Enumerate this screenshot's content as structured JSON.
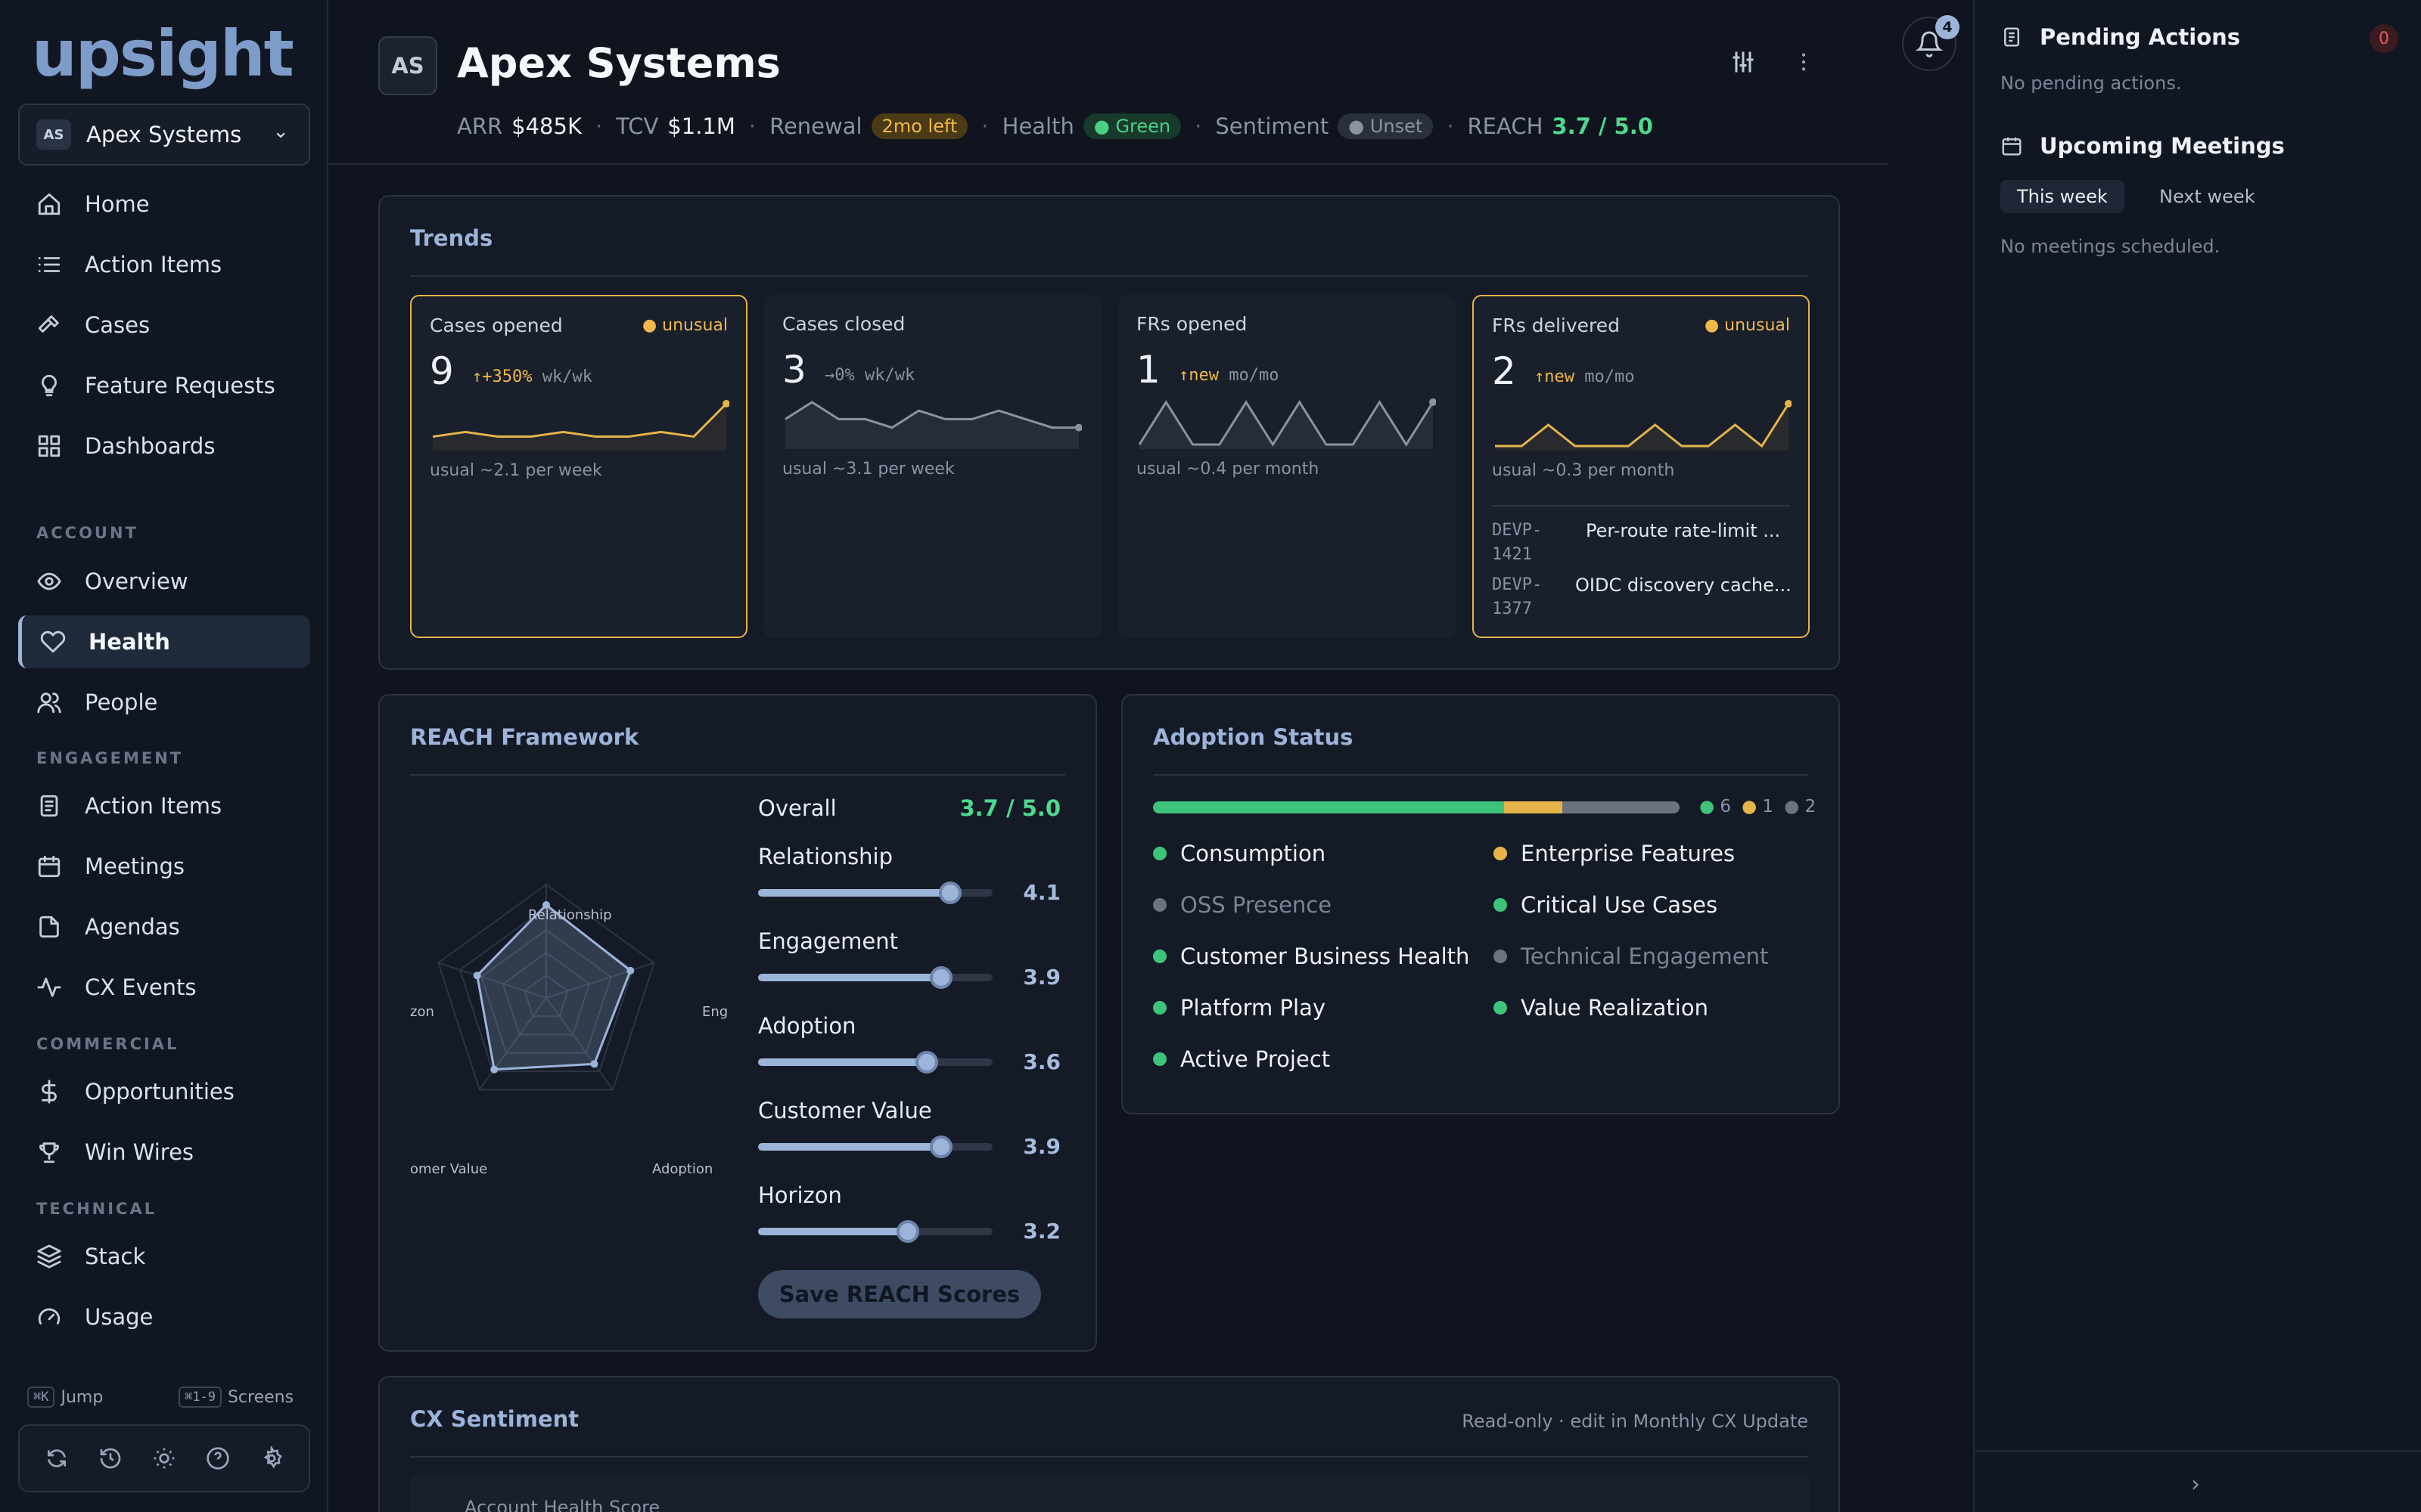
{
  "logo": "upsight",
  "account_switcher": {
    "initials": "AS",
    "name": "Apex Systems"
  },
  "nav_main": [
    {
      "label": "Home",
      "icon": "home-icon"
    },
    {
      "label": "Action Items",
      "icon": "list-icon"
    },
    {
      "label": "Cases",
      "icon": "hammer-icon"
    },
    {
      "label": "Feature Requests",
      "icon": "lightbulb-icon"
    },
    {
      "label": "Dashboards",
      "icon": "grid-icon"
    }
  ],
  "sections": {
    "account": "ACCOUNT",
    "engagement": "ENGAGEMENT",
    "commercial": "COMMERCIAL",
    "technical": "TECHNICAL"
  },
  "nav_account": [
    {
      "label": "Overview",
      "icon": "eye-icon"
    },
    {
      "label": "Health",
      "icon": "heart-icon",
      "active": true
    },
    {
      "label": "People",
      "icon": "people-icon"
    }
  ],
  "nav_engagement": [
    {
      "label": "Action Items",
      "icon": "document-icon"
    },
    {
      "label": "Meetings",
      "icon": "calendar-icon"
    },
    {
      "label": "Agendas",
      "icon": "file-icon"
    },
    {
      "label": "CX Events",
      "icon": "activity-icon"
    }
  ],
  "nav_commercial": [
    {
      "label": "Opportunities",
      "icon": "dollar-icon"
    },
    {
      "label": "Win Wires",
      "icon": "trophy-icon"
    }
  ],
  "nav_technical": [
    {
      "label": "Stack",
      "icon": "layers-icon"
    },
    {
      "label": "Usage",
      "icon": "gauge-icon"
    }
  ],
  "shortcuts": {
    "jump_key": "⌘K",
    "jump_label": "Jump",
    "screens_key": "⌘1-9",
    "screens_label": "Screens"
  },
  "header": {
    "initials": "AS",
    "title": "Apex Systems",
    "arr_label": "ARR",
    "arr": "$485K",
    "tcv_label": "TCV",
    "tcv": "$1.1M",
    "renewal_label": "Renewal",
    "renewal": "2mo left",
    "health_label": "Health",
    "health": "Green",
    "sentiment_label": "Sentiment",
    "sentiment": "Unset",
    "reach_label": "REACH",
    "reach": "3.7 / 5.0",
    "notifications": "4"
  },
  "trends": {
    "title": "Trends",
    "cards": [
      {
        "label": "Cases opened",
        "unusual": "unusual",
        "value": "9",
        "delta": "↑+350%",
        "period": "wk/wk",
        "usual": "usual ~2.1 per week",
        "series": [
          2,
          3,
          2,
          2,
          3,
          2,
          2,
          3,
          2,
          9
        ]
      },
      {
        "label": "Cases closed",
        "value": "3",
        "delta": "→0%",
        "period": "wk/wk",
        "usual": "usual ~3.1 per week",
        "series": [
          3,
          5,
          3,
          3,
          2,
          4,
          3,
          3,
          4,
          3,
          2,
          2
        ]
      },
      {
        "label": "FRs opened",
        "value": "1",
        "delta": "↑new",
        "period": "mo/mo",
        "usual": "usual ~0.4 per month",
        "series": [
          0,
          1,
          0,
          0,
          1,
          0,
          1,
          0,
          0,
          1,
          0,
          1
        ]
      },
      {
        "label": "FRs delivered",
        "unusual": "unusual",
        "value": "2",
        "delta": "↑new",
        "period": "mo/mo",
        "usual": "usual ~0.3 per month",
        "series": [
          0,
          0,
          1,
          0,
          0,
          0,
          1,
          0,
          0,
          1,
          0,
          2
        ],
        "items": [
          {
            "id": "DEVP-1421",
            "title": "Per-route rate-limit ..."
          },
          {
            "id": "DEVP-1377",
            "title": "OIDC discovery cache..."
          }
        ]
      }
    ]
  },
  "reach": {
    "title": "REACH Framework",
    "radar_labels": [
      "Relationship",
      "Eng",
      "Adoption",
      "omer Value",
      "zon"
    ],
    "overall_label": "Overall",
    "overall": "3.7 / 5.0",
    "scores": [
      {
        "name": "Relationship",
        "score": "4.1",
        "value": 4.1
      },
      {
        "name": "Engagement",
        "score": "3.9",
        "value": 3.9
      },
      {
        "name": "Adoption",
        "score": "3.6",
        "value": 3.6
      },
      {
        "name": "Customer Value",
        "score": "3.9",
        "value": 3.9
      },
      {
        "name": "Horizon",
        "score": "3.2",
        "value": 3.2
      }
    ],
    "max": 5,
    "save_label": "Save REACH Scores"
  },
  "adoption": {
    "title": "Adoption Status",
    "green_count": "6",
    "amber_count": "1",
    "gray_count": "2",
    "colors": {
      "green": "#3ec47a",
      "amber": "#e7b44a",
      "gray": "#6b7280"
    },
    "items": [
      {
        "label": "Consumption",
        "status": "green"
      },
      {
        "label": "Enterprise Features",
        "status": "amber"
      },
      {
        "label": "OSS Presence",
        "status": "gray"
      },
      {
        "label": "Critical Use Cases",
        "status": "green"
      },
      {
        "label": "Customer Business Health",
        "status": "green"
      },
      {
        "label": "Technical Engagement",
        "status": "gray"
      },
      {
        "label": "Platform Play",
        "status": "green"
      },
      {
        "label": "Value Realization",
        "status": "green"
      },
      {
        "label": "Active Project",
        "status": "green"
      }
    ]
  },
  "cx": {
    "title": "CX Sentiment",
    "note": "Read-only · edit in Monthly CX Update",
    "row_label": "Account Health Score"
  },
  "right": {
    "pending_title": "Pending Actions",
    "pending_count": "0",
    "pending_empty": "No pending actions.",
    "meetings_title": "Upcoming Meetings",
    "tab_this": "This week",
    "tab_next": "Next week",
    "meetings_empty": "No meetings scheduled."
  }
}
